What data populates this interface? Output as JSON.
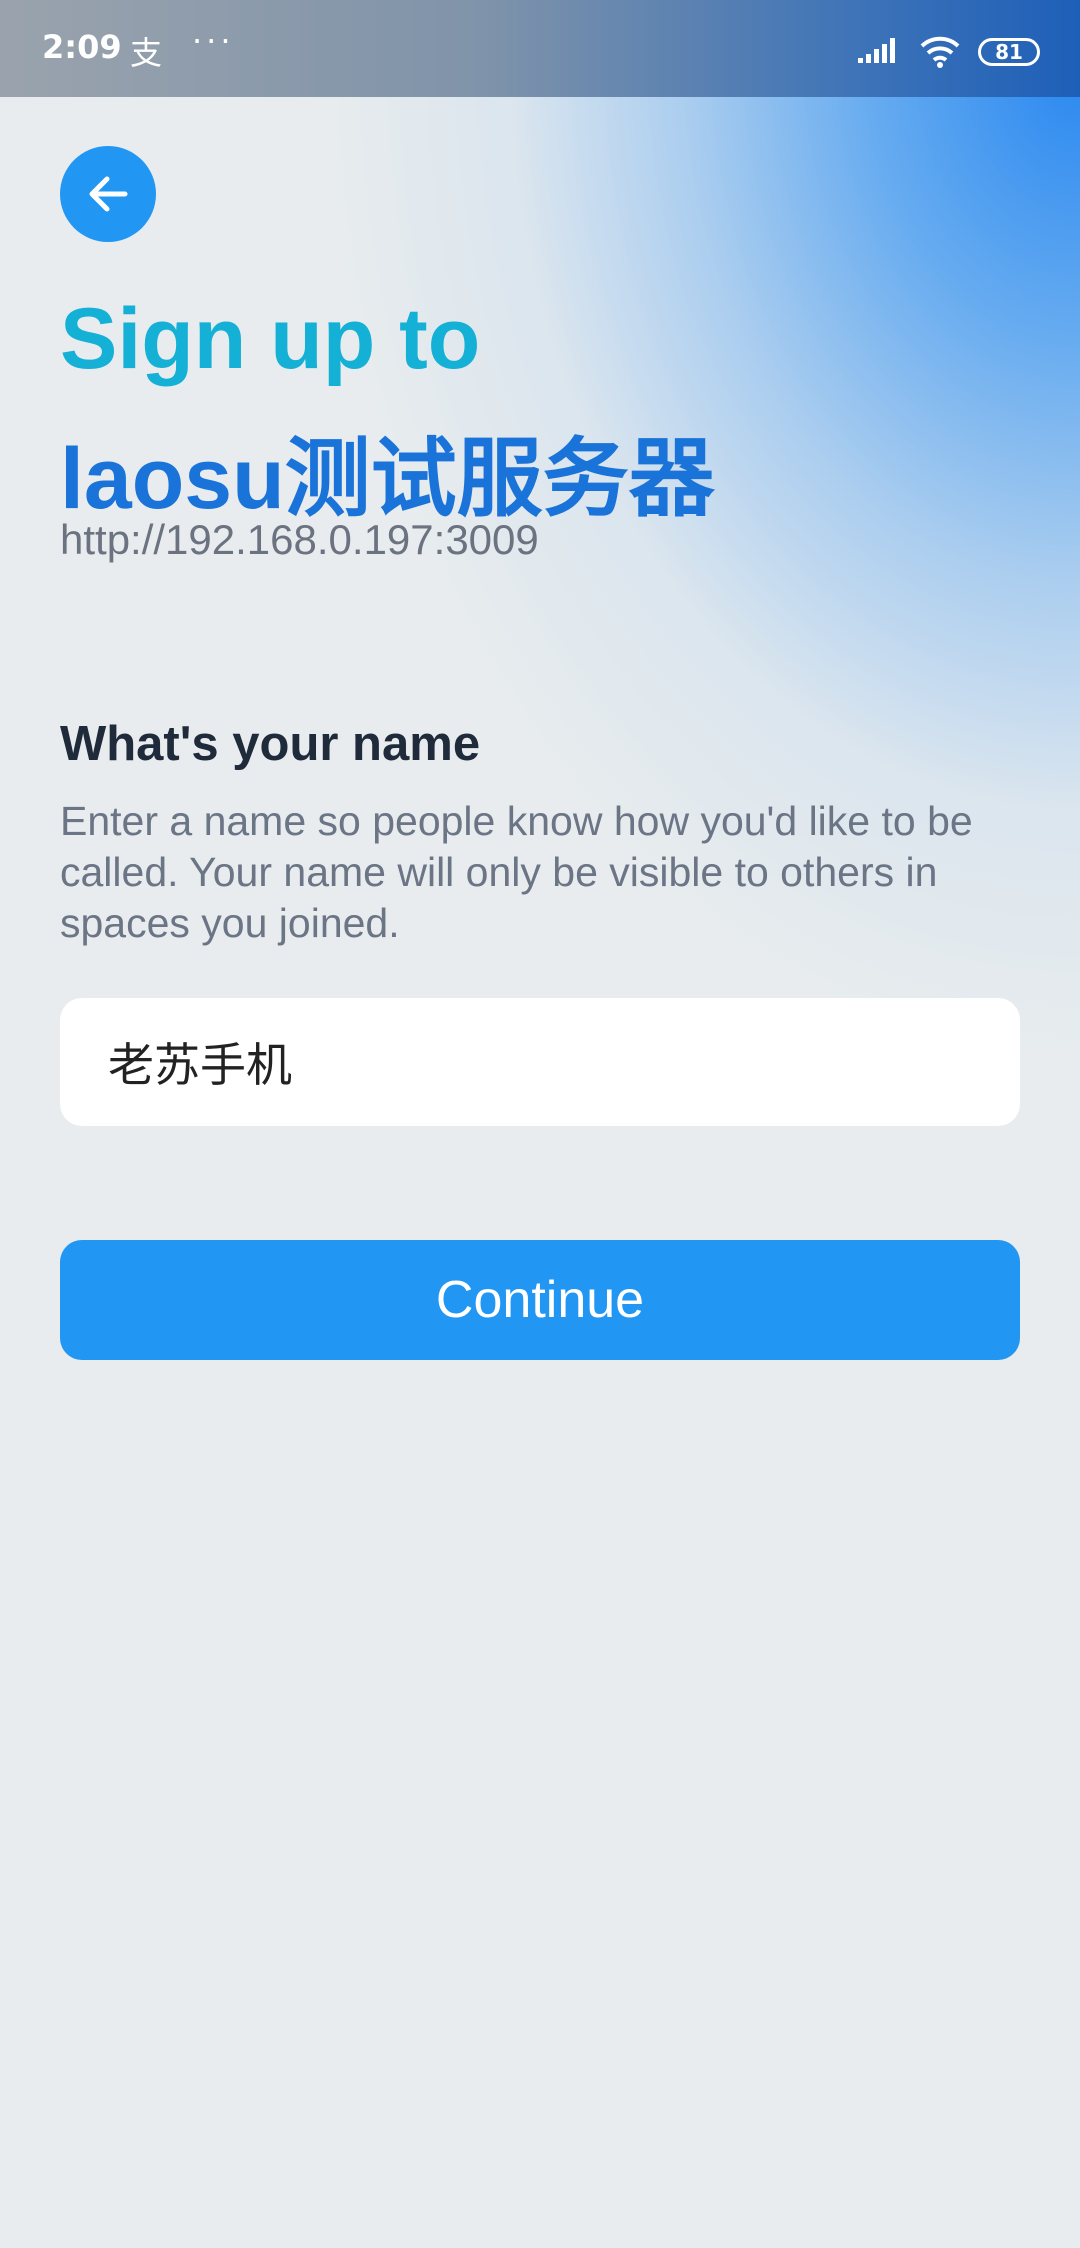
{
  "status_bar": {
    "time": "2:09",
    "app_glyph": "支",
    "dots": "···",
    "battery": "81"
  },
  "header": {
    "back_icon": "arrow-left-icon",
    "title_line1": "Sign up to",
    "title_line2": "laosu测试服务器",
    "server_url": "http://192.168.0.197:3009"
  },
  "form": {
    "heading": "What's your name",
    "description": "Enter a name so people know how you'd like to be called. Your name will only be visible to others in spaces you joined.",
    "name_value": "老苏手机",
    "continue_label": "Continue"
  },
  "colors": {
    "accent": "#2196f3",
    "title_primary": "#14b0d6",
    "title_secondary": "#1a73d8",
    "background": "#e8ecee"
  }
}
